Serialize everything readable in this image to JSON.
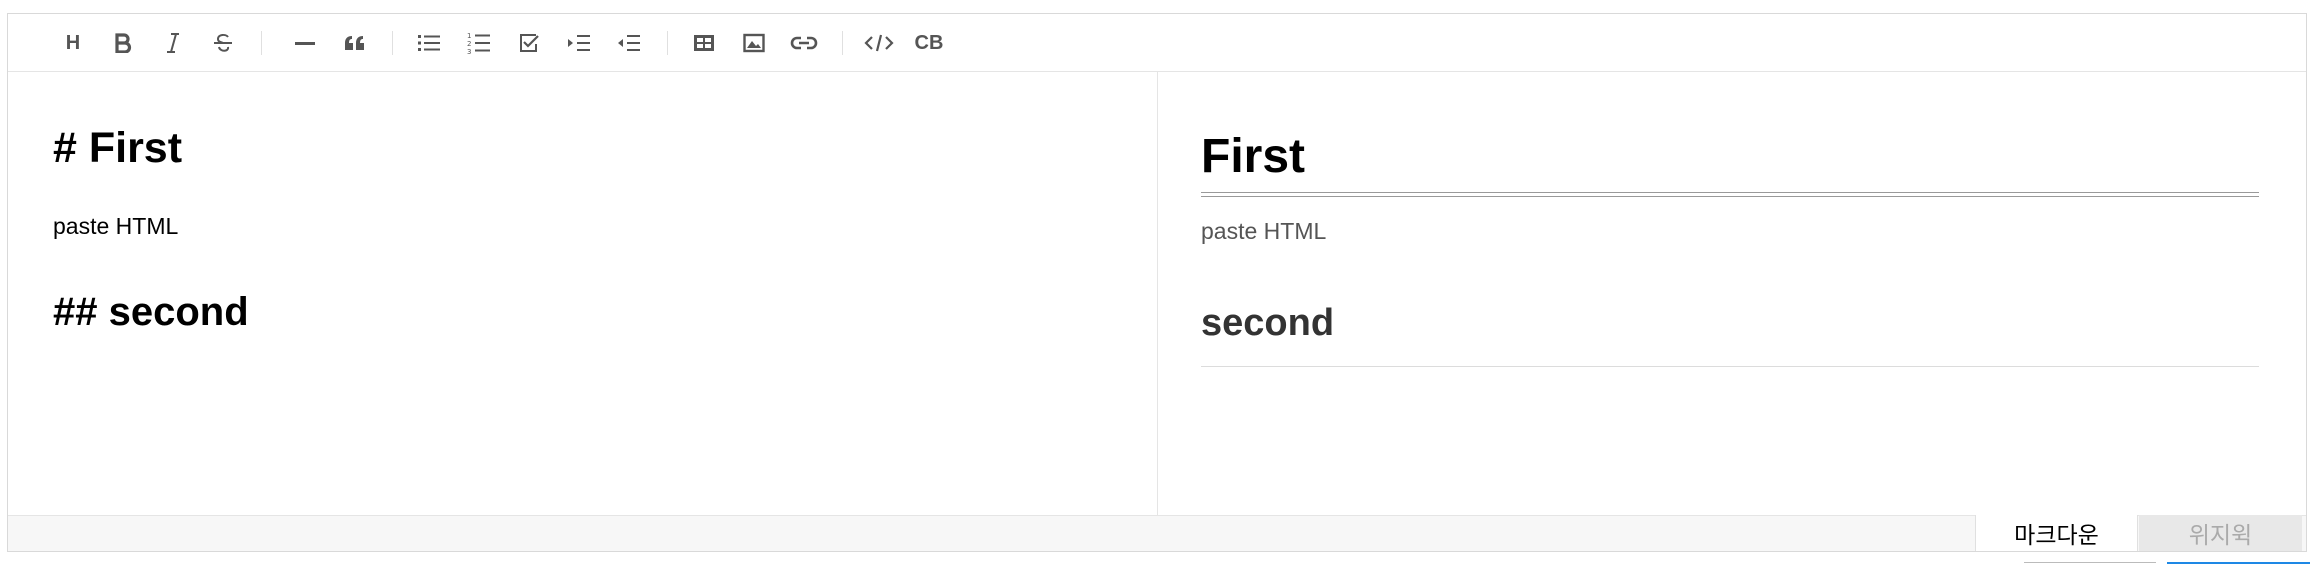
{
  "toolbar": {
    "heading_label": "H",
    "codeblock_label": "CB",
    "buttons": [
      {
        "name": "heading",
        "icon": "heading-icon"
      },
      {
        "name": "bold",
        "icon": "bold-icon"
      },
      {
        "name": "italic",
        "icon": "italic-icon"
      },
      {
        "name": "strike",
        "icon": "strikethrough-icon"
      },
      {
        "name": "hr",
        "icon": "horizontal-rule-icon"
      },
      {
        "name": "quote",
        "icon": "quote-icon"
      },
      {
        "name": "ul",
        "icon": "bullet-list-icon"
      },
      {
        "name": "ol",
        "icon": "numbered-list-icon"
      },
      {
        "name": "task",
        "icon": "task-list-icon"
      },
      {
        "name": "indent",
        "icon": "indent-icon"
      },
      {
        "name": "outdent",
        "icon": "outdent-icon"
      },
      {
        "name": "table",
        "icon": "table-icon"
      },
      {
        "name": "image",
        "icon": "image-icon"
      },
      {
        "name": "link",
        "icon": "link-icon"
      },
      {
        "name": "code",
        "icon": "code-icon"
      },
      {
        "name": "codeblock",
        "icon": "codeblock-icon"
      }
    ]
  },
  "markdown": {
    "line1": "# First",
    "line2": "paste HTML",
    "line3": "## second"
  },
  "preview": {
    "h1": "First",
    "p": "paste HTML",
    "h2": "second"
  },
  "modes": {
    "markdown_label": "마크다운",
    "wysiwyg_label": "위지윅",
    "active": "markdown"
  }
}
